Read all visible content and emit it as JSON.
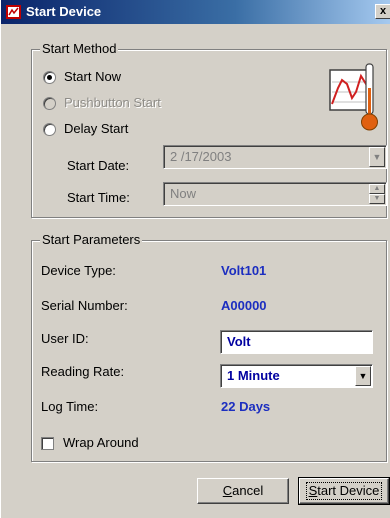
{
  "window": {
    "title": "Start Device",
    "close_glyph": "x"
  },
  "start_method": {
    "legend": "Start Method",
    "options": [
      {
        "label": "Start Now",
        "selected": true,
        "enabled": true
      },
      {
        "label": "Pushbutton Start",
        "selected": false,
        "enabled": false
      },
      {
        "label": "Delay Start",
        "selected": false,
        "enabled": true
      }
    ],
    "start_date_label": "Start Date:",
    "start_date_value": "2 /17/2003",
    "start_time_label": "Start Time:",
    "start_time_value": "Now",
    "icon": "chart-thermometer-icon"
  },
  "start_parameters": {
    "legend": "Start Parameters",
    "device_type_label": "Device Type:",
    "device_type_value": "Volt101",
    "serial_number_label": "Serial Number:",
    "serial_number_value": "A00000",
    "user_id_label": "User ID:",
    "user_id_value": "Volt",
    "reading_rate_label": "Reading Rate:",
    "reading_rate_value": "1 Minute",
    "log_time_label": "Log Time:",
    "log_time_value": "22 Days",
    "wrap_around_label": "Wrap Around",
    "wrap_around_checked": false
  },
  "buttons": {
    "cancel_first": "C",
    "cancel_rest": "ancel",
    "start_first": "S",
    "start_rest": "tart Device"
  },
  "colors": {
    "value_blue": "#1c2ec0",
    "face": "#d4d0c8",
    "title_start": "#0a246a"
  }
}
